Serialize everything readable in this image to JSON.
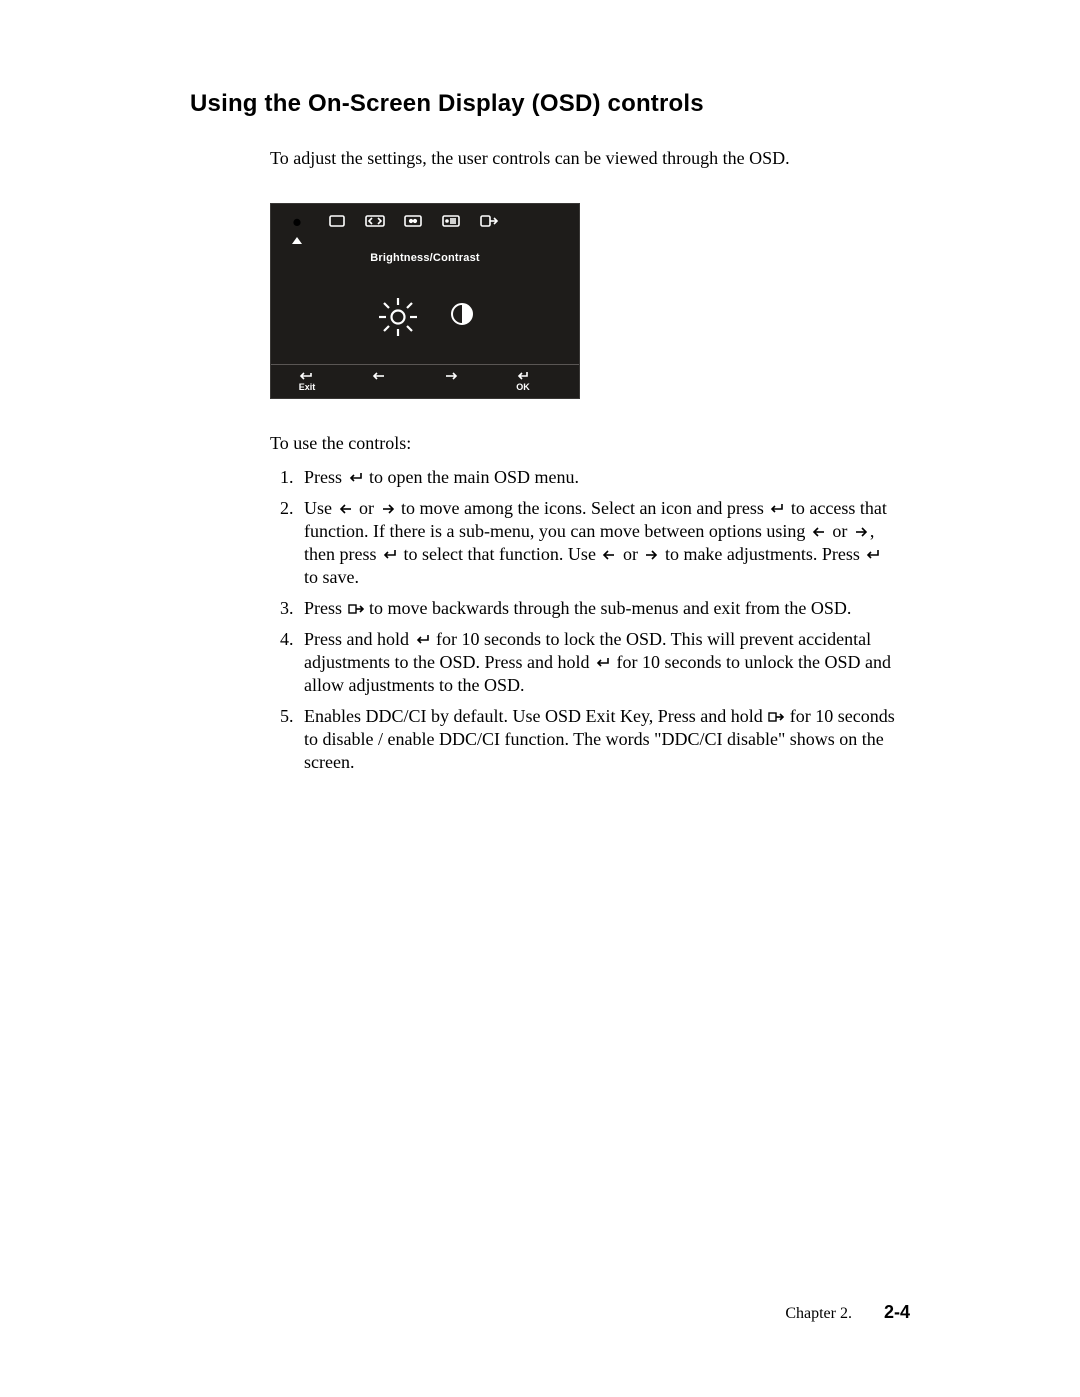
{
  "title": "Using the On-Screen Display (OSD) controls",
  "intro": "To adjust the settings,  the user controls can be viewed through the OSD.",
  "lead_in": "To use the controls:",
  "osd": {
    "panel_title": "Brightness/Contrast",
    "tab_icons": [
      "brightness",
      "position",
      "scaling",
      "input",
      "menu",
      "exit"
    ],
    "bottom": {
      "exit_label": "Exit",
      "ok_label": "OK"
    }
  },
  "instructions": {
    "1a": "Press ",
    "1b": " to open the main OSD menu.",
    "2a": "Use ",
    "2b": " or ",
    "2c": " to move among the icons. Select an icon and press  ",
    "2d": " to access that function. If there is a sub-menu, you can move between options using  ",
    "2e": " or  ",
    "2f": ", then press  ",
    "2g": " to select that function. Use ",
    "2h": " or  ",
    "2i": " to make adjustments. Press ",
    "2j": " to save.",
    "3a": "Press ",
    "3b": " to move backwards through the sub-menus and exit from the OSD.",
    "4a": "Press and hold  ",
    "4b": "  for 10 seconds to lock the OSD. This will prevent accidental adjustments to the OSD. Press and hold  ",
    "4c": "  for 10 seconds to unlock the OSD and allow adjustments to the OSD.",
    "5a": "Enables DDC/CI by default. Use OSD Exit Key,  Press and hold ",
    "5b": " for 10 seconds to disable / enable DDC/CI function. The words \"DDC/CI disable\" shows on the screen."
  },
  "footer": {
    "chapter": "Chapter 2.",
    "page": "2-4"
  }
}
